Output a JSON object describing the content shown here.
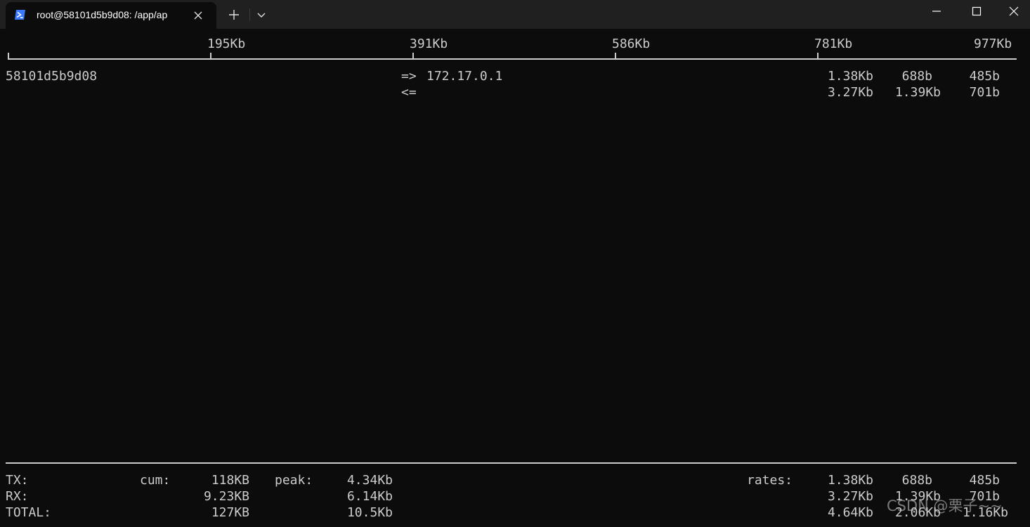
{
  "window": {
    "tab_title": "root@58101d5b9d08: /app/ap",
    "tab_icon": "powershell-icon",
    "accent_color": "#3b78ff",
    "background_color": "#0c0c0c",
    "text_color": "#cccccc"
  },
  "scale": {
    "ticks": [
      "195Kb",
      "391Kb",
      "586Kb",
      "781Kb",
      "977Kb"
    ]
  },
  "host_row": {
    "host": "58101d5b9d08",
    "send_arrow": "=>",
    "peer": "172.17.0.1",
    "recv_arrow": "<=",
    "send_rates": [
      "1.38Kb",
      "688b",
      "485b"
    ],
    "recv_rates": [
      "3.27Kb",
      "1.39Kb",
      "701b"
    ]
  },
  "totals": {
    "tx_label": "TX:",
    "rx_label": "RX:",
    "total_label": "TOTAL:",
    "cum_label": "cum:",
    "peak_label": "peak:",
    "rates_label": "rates:",
    "tx_cum": "118KB",
    "rx_cum": "9.23KB",
    "total_cum": "127KB",
    "tx_peak": "4.34Kb",
    "rx_peak": "6.14Kb",
    "total_peak": "10.5Kb",
    "tx_rates": [
      "1.38Kb",
      "688b",
      "485b"
    ],
    "rx_rates": [
      "3.27Kb",
      "1.39Kb",
      "701b"
    ],
    "total_rates": [
      "4.64Kb",
      "2.06Kb",
      "1.16Kb"
    ]
  },
  "watermark": "CSDN @栗子~~"
}
